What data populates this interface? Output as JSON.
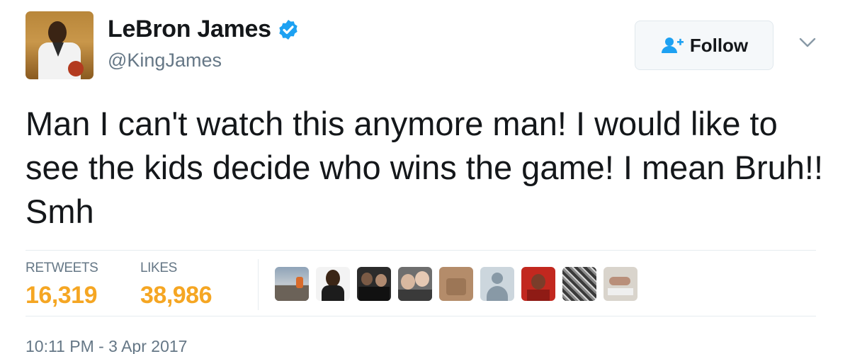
{
  "user": {
    "name": "LeBron James",
    "handle": "@KingJames",
    "verified_icon": "verified-badge-icon",
    "avatar_icon": "profile-photo"
  },
  "follow_button": {
    "label": "Follow",
    "icon": "add-user-icon"
  },
  "menu": {
    "icon": "chevron-down-icon"
  },
  "tweet": {
    "text": "Man I can't watch this anymore man! I would like to see the kids decide who wins the game! I mean Bruh!! Smh"
  },
  "stats": {
    "retweets_label": "RETWEETS",
    "retweets_value": "16,319",
    "likes_label": "LIKES",
    "likes_value": "38,986"
  },
  "likers": [
    {
      "name": "liker-avatar-1"
    },
    {
      "name": "liker-avatar-2"
    },
    {
      "name": "liker-avatar-3"
    },
    {
      "name": "liker-avatar-4"
    },
    {
      "name": "liker-avatar-5"
    },
    {
      "name": "liker-avatar-6"
    },
    {
      "name": "liker-avatar-7"
    },
    {
      "name": "liker-avatar-8"
    },
    {
      "name": "liker-avatar-9"
    }
  ],
  "timestamp": "10:11 PM - 3 Apr 2017",
  "colors": {
    "accent": "#1da1f2",
    "stat_value": "#f5a623",
    "muted": "#657786"
  }
}
